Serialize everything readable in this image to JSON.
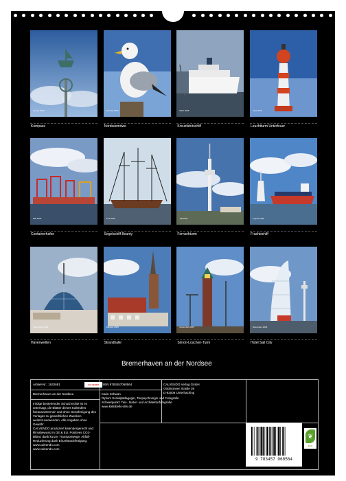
{
  "title": "Bremerhaven an der Nordsee",
  "months": [
    {
      "date": "Januar 2025",
      "caption": "Kompass",
      "scene": "kompass"
    },
    {
      "date": "Februar 2025",
      "caption": "Nordseemöwe",
      "scene": "moewe"
    },
    {
      "date": "März 2025",
      "caption": "Kreuzfahrtschiff",
      "scene": "kreuz"
    },
    {
      "date": "April 2025",
      "caption": "Leuchtturm Unterfeuer",
      "scene": "leucht"
    },
    {
      "date": "Mai 2025",
      "caption": "Containerhafen",
      "scene": "container"
    },
    {
      "date": "Juni 2025",
      "caption": "Segelschiff Bounty",
      "scene": "bounty"
    },
    {
      "date": "Juli 2025",
      "caption": "Fernsehturm",
      "scene": "fernseh"
    },
    {
      "date": "August 2025",
      "caption": "Frachtschiff",
      "scene": "fracht"
    },
    {
      "date": "September 2025",
      "caption": "Havenwelten",
      "scene": "haven"
    },
    {
      "date": "Oktober 2025",
      "caption": "Strandhalle",
      "scene": "strand"
    },
    {
      "date": "November 2025",
      "caption": "Simon-Loschen-Turm",
      "scene": "simon"
    },
    {
      "date": "Dezember 2025",
      "caption": "Hotel Sail City",
      "scene": "sail"
    }
  ],
  "info": {
    "article": "Artikel-Nr.: 1632681",
    "logo": "CALVENDO",
    "product_title": "Bremerhaven an der Nordsee",
    "legal": [
      "Infolge bestehender Schutzrechte ist es",
      "untersagt, die Blätter dieses Kalenders",
      "herauszutrennen und ohne Genehmigung des",
      "Verlages zu gewerblichen Zwecken",
      "weiterzuverwenden. Alle Angaben ohne",
      "Gewähr.",
      "CALVENDO produziert kalendergerecht und",
      "klimabewusst in DE & EU. Positives CO2-",
      "Bilanz dank kurzer Transportwege. Abfall-",
      "Reduzierung dank Einzelstückfertigung.",
      "www.calvendo.com",
      "www.calvendo.com"
    ],
    "isbn": "ISBN 9783457068564",
    "author": "Karin Schwan",
    "author_desc": [
      "Diplom Sozialpädagogin, Tierpsychologin und Fotografin",
      "Schwerpunkt: Tier-, Natur- und Architekturfotografie",
      "www.kallobello-ulm.de"
    ],
    "publisher": [
      "CALVENDO Verlag GmbH",
      "Ottobrunner Straße 39",
      "D-82008 Unterhaching"
    ],
    "barcode_number": "9 783457 068564",
    "eco_label": "eco"
  }
}
